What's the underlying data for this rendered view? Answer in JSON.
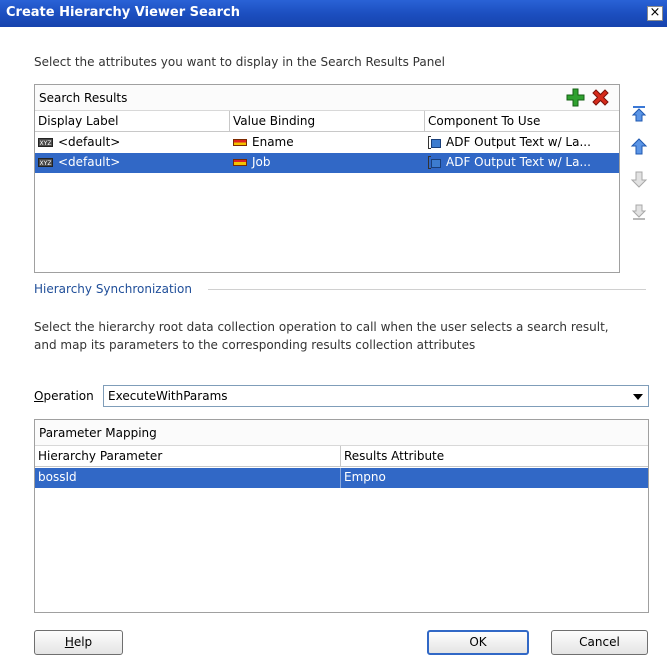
{
  "window": {
    "title": "Create Hierarchy Viewer Search",
    "close_glyph": "×"
  },
  "instruction": "Select the attributes you want to display in the Search Results Panel",
  "search_results": {
    "title": "Search Results",
    "columns": [
      "Display Label",
      "Value Binding",
      "Component To Use"
    ],
    "rows": [
      {
        "display_label": "<default>",
        "value_binding": "Ename",
        "component": "ADF Output Text w/ La...",
        "selected": false
      },
      {
        "display_label": "<default>",
        "value_binding": "Job",
        "component": "ADF Output Text w/ La...",
        "selected": true
      }
    ],
    "icon_text": "XYZ"
  },
  "section": {
    "label": "Hierarchy Synchronization"
  },
  "description": [
    "Select the hierarchy root data collection operation to call when the user selects a search result,",
    "and map its parameters to the corresponding results collection attributes"
  ],
  "operation": {
    "label_prefix": "",
    "label_underlined": "O",
    "label_rest": "peration",
    "value": "ExecuteWithParams"
  },
  "parameter_mapping": {
    "title": "Parameter Mapping",
    "columns": [
      "Hierarchy Parameter",
      "Results Attribute"
    ],
    "rows": [
      {
        "parameter": "bossId",
        "attribute": "Empno",
        "selected": true
      }
    ]
  },
  "buttons": {
    "help_underlined": "H",
    "help_rest": "elp",
    "ok": "OK",
    "cancel": "Cancel"
  },
  "colors": {
    "accent": "#3168c6",
    "titlebar": "#1c4fc0",
    "add": "#2fa12f",
    "delete": "#d62b1b"
  }
}
